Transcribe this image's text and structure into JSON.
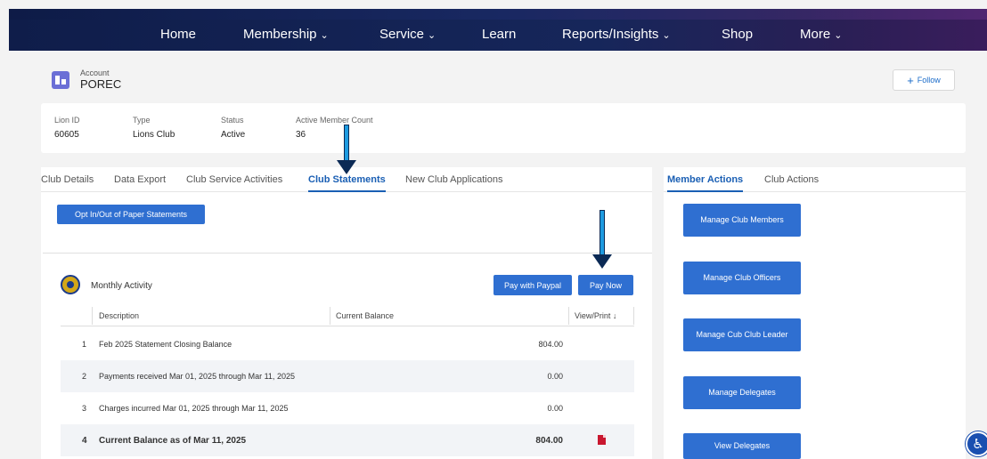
{
  "nav": {
    "items": [
      {
        "label": "Home",
        "dropdown": false
      },
      {
        "label": "Membership",
        "dropdown": true
      },
      {
        "label": "Service",
        "dropdown": true
      },
      {
        "label": "Learn",
        "dropdown": false
      },
      {
        "label": "Reports/Insights",
        "dropdown": true
      },
      {
        "label": "Shop",
        "dropdown": false
      },
      {
        "label": "More",
        "dropdown": true
      }
    ],
    "chevron": "⌄"
  },
  "account": {
    "label": "Account",
    "name": "POREC",
    "follow_label": "Follow",
    "follow_icon": "+"
  },
  "info": {
    "fields": [
      {
        "label": "Lion ID",
        "value": "60605"
      },
      {
        "label": "Type",
        "value": "Lions Club"
      },
      {
        "label": "Status",
        "value": "Active"
      },
      {
        "label": "Active Member Count",
        "value": "36"
      }
    ]
  },
  "left_tabs": [
    {
      "label": "Club Details",
      "active": false
    },
    {
      "label": "Data Export",
      "active": false
    },
    {
      "label": "Club Service Activities",
      "active": false
    },
    {
      "label": "Club Statements",
      "active": true
    },
    {
      "label": "New Club Applications",
      "active": false
    }
  ],
  "statements": {
    "opt_button": "Opt In/Out of Paper Statements",
    "monthly_title": "Monthly Activity",
    "pay_paypal": "Pay with Paypal",
    "pay_now": "Pay Now",
    "columns": {
      "description": "Description",
      "balance": "Current Balance",
      "view": "View/Print ↓"
    },
    "rows": [
      {
        "num": "1",
        "description": "Feb 2025 Statement Closing Balance",
        "amount": "804.00",
        "pdf": false,
        "bold": false
      },
      {
        "num": "2",
        "description": "Payments received Mar 01, 2025 through Mar 11, 2025",
        "amount": "0.00",
        "pdf": false,
        "bold": false
      },
      {
        "num": "3",
        "description": "Charges incurred Mar 01, 2025 through Mar 11, 2025",
        "amount": "0.00",
        "pdf": false,
        "bold": false
      },
      {
        "num": "4",
        "description": "Current Balance as of Mar 11, 2025",
        "amount": "804.00",
        "pdf": true,
        "bold": true
      }
    ]
  },
  "right_tabs": [
    {
      "label": "Member Actions",
      "active": true
    },
    {
      "label": "Club Actions",
      "active": false
    }
  ],
  "member_actions": [
    "Manage Club Members",
    "Manage Club Officers",
    "Manage Cub Club Leader",
    "Manage Delegates",
    "View Delegates"
  ],
  "colors": {
    "nav_bg": "#16265a",
    "primary_button": "#2f6fd1",
    "annotation_arrow": "#1e9be0",
    "pdf_icon": "#c9172f"
  },
  "icons": {
    "accessibility": "accessibility-icon",
    "account": "account-icon",
    "lions_logo": "lions-logo-icon",
    "pdf": "pdf-icon"
  }
}
